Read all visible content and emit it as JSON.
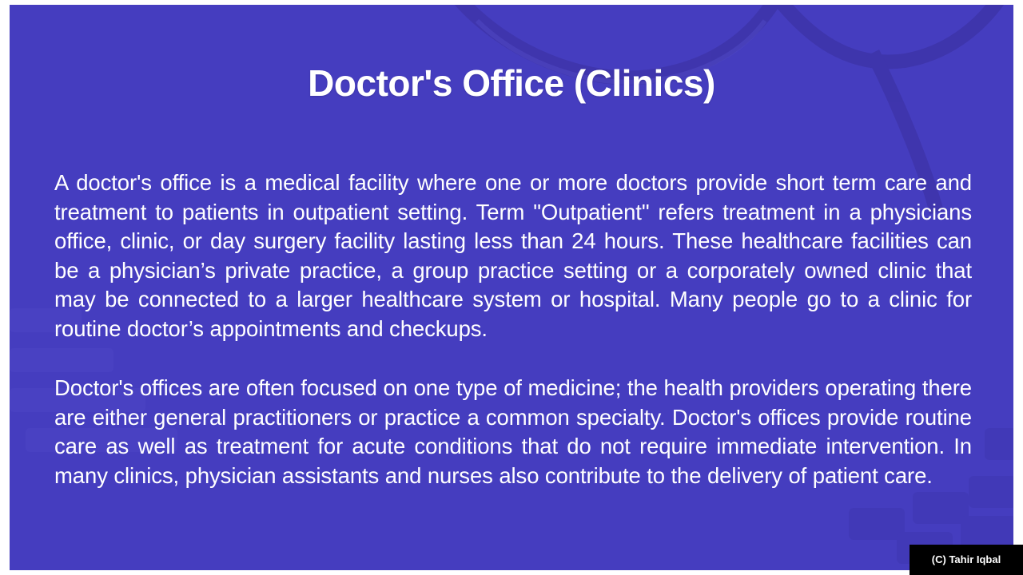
{
  "slide": {
    "background_color": "#453dbf",
    "text_color": "#ffffff",
    "title": "Doctor's Office (Clinics)",
    "paragraphs": [
      "A doctor's office is a medical facility where one or more doctors provide short term care and treatment to patients in outpatient setting. Term \"Outpatient\" refers treatment in a physicians office, clinic, or day surgery facility lasting less than 24 hours. These healthcare facilities can be a physician’s private practice, a group practice setting or a corporately owned clinic that may be connected to a larger healthcare system or hospital. Many people go to a clinic for routine doctor’s appointments and checkups.",
      "Doctor's offices are often focused on one type of medicine; the health providers operating there are either general practitioners or practice a common specialty. Doctor's offices provide routine care as well as treatment for acute conditions that do not require immediate intervention. In many clinics, physician assistants and nurses also contribute to the delivery of patient care."
    ]
  },
  "watermark": {
    "text": "(C) Tahir Iqbal",
    "background_color": "#000000"
  }
}
